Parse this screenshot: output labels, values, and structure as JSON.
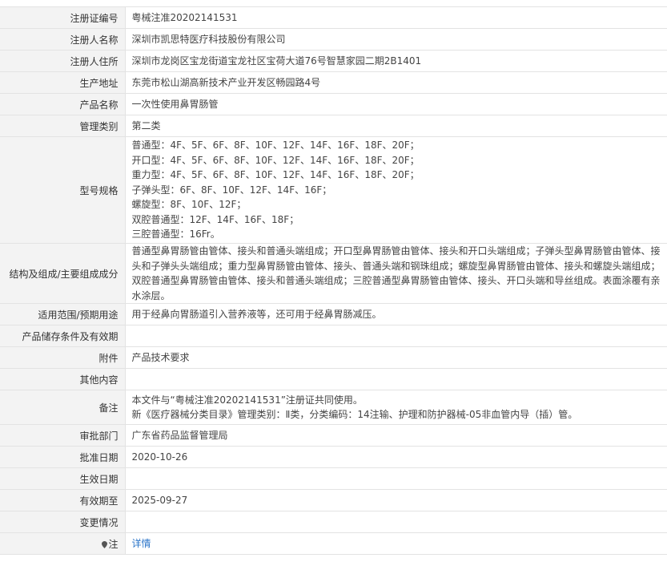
{
  "rows": [
    {
      "label": "注册证编号",
      "value": "粤械注准20202141531"
    },
    {
      "label": "注册人名称",
      "value": "深圳市凯思特医疗科技股份有限公司"
    },
    {
      "label": "注册人住所",
      "value": "深圳市龙岗区宝龙街道宝龙社区宝荷大道76号智慧家园二期2B1401"
    },
    {
      "label": "生产地址",
      "value": "东莞市松山湖高新技术产业开发区畅园路4号"
    },
    {
      "label": "产品名称",
      "value": "一次性使用鼻胃肠管"
    },
    {
      "label": "管理类别",
      "value": "第二类"
    }
  ],
  "spec": {
    "label": "型号规格",
    "lines": [
      "普通型：4F、5F、6F、8F、10F、12F、14F、16F、18F、20F；",
      "开口型：4F、5F、6F、8F、10F、12F、14F、16F、18F、20F；",
      "重力型：4F、5F、6F、8F、10F、12F、14F、16F、18F、20F；",
      "子弹头型：6F、8F、10F、12F、14F、16F；",
      "螺旋型：8F、10F、12F；",
      "双腔普通型：12F、14F、16F、18F；",
      "三腔普通型：16Fr。"
    ]
  },
  "structure": {
    "label": "结构及组成/主要组成成分",
    "value": "普通型鼻胃肠管由管体、接头和普通头端组成；开口型鼻胃肠管由管体、接头和开口头端组成；子弹头型鼻胃肠管由管体、接头和子弹头头端组成；重力型鼻胃肠管由管体、接头、普通头端和钢珠组成；螺旋型鼻胃肠管由管体、接头和螺旋头端组成；双腔普通型鼻胃肠管由管体、接头和普通头端组成；三腔普通型鼻胃肠管由管体、接头、开口头端和导丝组成。表面涂覆有亲水涂层。"
  },
  "rows2": [
    {
      "label": "适用范围/预期用途",
      "value": "用于经鼻向胃肠道引入营养液等，还可用于经鼻胃肠减压。"
    },
    {
      "label": "产品储存条件及有效期",
      "value": ""
    },
    {
      "label": "附件",
      "value": "产品技术要求"
    },
    {
      "label": "其他内容",
      "value": ""
    }
  ],
  "note": {
    "label": "备注",
    "lines": [
      "本文件与“粤械注准20202141531”注册证共同使用。",
      "新《医疗器械分类目录》管理类别：Ⅱ类，分类编码：14注输、护理和防护器械-05非血管内导（插）管。"
    ]
  },
  "rows3": [
    {
      "label": "审批部门",
      "value": "广东省药品监督管理局"
    },
    {
      "label": "批准日期",
      "value": "2020-10-26"
    },
    {
      "label": "生效日期",
      "value": ""
    },
    {
      "label": "有效期至",
      "value": "2025-09-27"
    },
    {
      "label": "变更情况",
      "value": ""
    }
  ],
  "footnote": {
    "label": "注",
    "icon": "location-pin-icon",
    "link": "详情"
  },
  "colors": {
    "label_bg": "#f3f3f3",
    "border": "#e3e3e3",
    "link": "#2a74c9",
    "icon": "#555555"
  }
}
